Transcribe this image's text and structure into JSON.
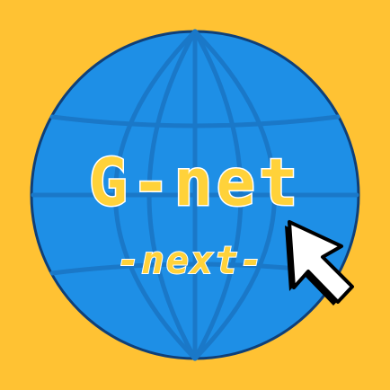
{
  "logo": {
    "title": "G-net",
    "subtitle": "-next-"
  },
  "colors": {
    "background": "#ffc233",
    "globe": "#1e8fe6",
    "globe_lines": "#1a78c8",
    "globe_outline": "#0f3f78",
    "text_fill": "#ffd23a",
    "text_stroke": "#ffffff",
    "cursor_fill": "#ffffff",
    "cursor_stroke": "#000000"
  },
  "icons": {
    "globe": "globe-icon",
    "cursor": "mouse-pointer-icon"
  }
}
